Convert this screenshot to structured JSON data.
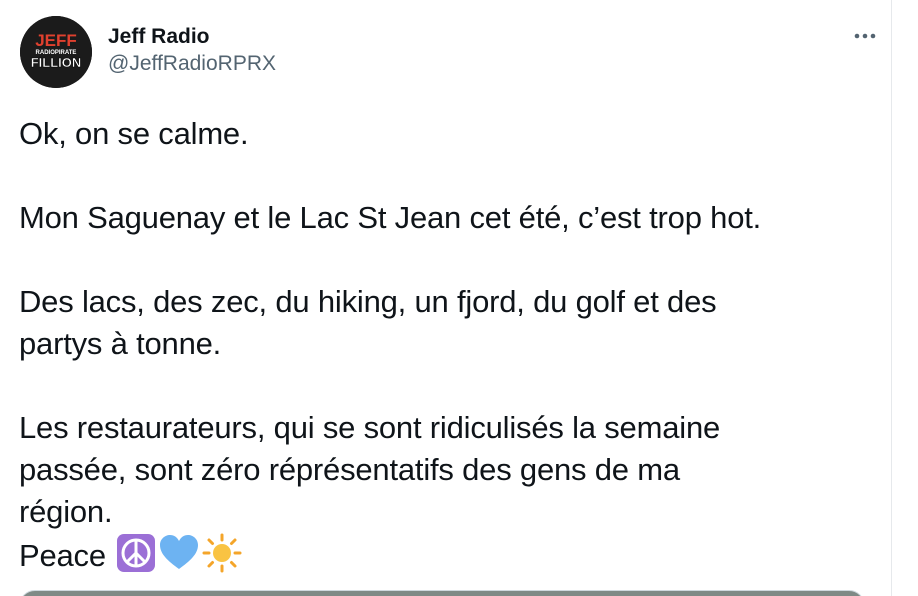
{
  "tweet": {
    "author": {
      "display_name": "Jeff Radio",
      "handle": "@JeffRadioRPRX",
      "avatar_logo": {
        "line1": "JEFF",
        "line2": "RADIOPIRATE",
        "line3": "FILLION"
      }
    },
    "more_icon": "more-horizontal-icon",
    "text": {
      "p1": "Ok, on se calme.",
      "p2": "Mon Saguenay et le Lac St Jean cet été, c’est trop hot.",
      "p3_line1": "Des lacs, des zec, du hiking, un fjord, du golf et des",
      "p3_line2": "partys à tonne.",
      "p4_line1": "Les restaurateurs, qui se sont ridiculisés la semaine",
      "p4_line2": "passée, sont zéro réprésentatifs des gens de ma",
      "p4_line3": "région.",
      "p5": "Peace"
    },
    "emojis": [
      "peace-symbol-emoji",
      "blue-heart-emoji",
      "sun-emoji"
    ]
  },
  "colors": {
    "text_primary": "#0f1419",
    "text_secondary": "#536471",
    "avatar_bg": "#1a1a1a",
    "logo_red": "#e0402e",
    "peace_purple": "#9b6fd6",
    "heart_blue": "#6db3f2",
    "sun_orange": "#f4a52a"
  }
}
